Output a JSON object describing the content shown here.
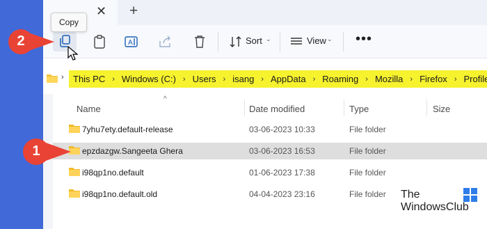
{
  "toolbar": {
    "tooltip": "Copy",
    "sort_label": "Sort",
    "view_label": "View",
    "more_label": "•••"
  },
  "breadcrumb": [
    "This PC",
    "Windows (C:)",
    "Users",
    "isang",
    "AppData",
    "Roaming",
    "Mozilla",
    "Firefox",
    "Profiles"
  ],
  "columns": {
    "name": "Name",
    "date": "Date modified",
    "type": "Type",
    "size": "Size"
  },
  "rows": [
    {
      "name": "7yhu7ety.default-release",
      "date": "03-06-2023 10:33",
      "type": "File folder"
    },
    {
      "name": "epzdazgw.Sangeeta Ghera",
      "date": "03-06-2023 16:53",
      "type": "File folder"
    },
    {
      "name": "i98qp1no.default",
      "date": "01-06-2023 17:38",
      "type": "File folder"
    },
    {
      "name": "i98qp1no.default.old",
      "date": "04-04-2023 23:16",
      "type": "File folder"
    }
  ],
  "callouts": {
    "one": "1",
    "two": "2"
  },
  "brand": {
    "line1": "The",
    "line2": "WindowsClub"
  },
  "colors": {
    "accent_bg": "#4169d8",
    "highlight": "#f6f22e",
    "callout": "#e94335",
    "selected_row": "#dedede"
  }
}
